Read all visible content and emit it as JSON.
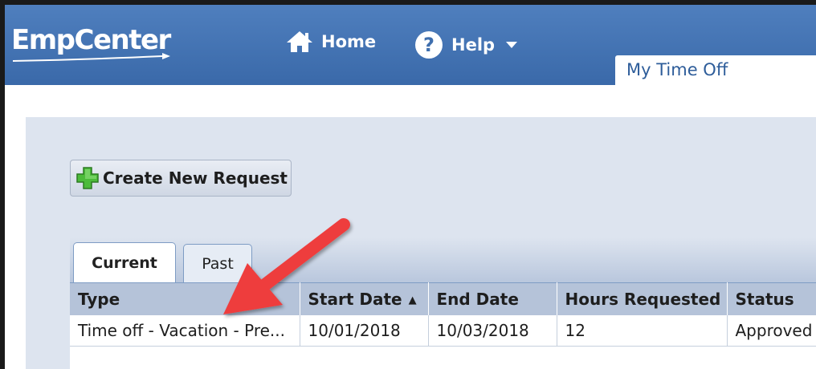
{
  "header": {
    "logo_text": "EmpCenter",
    "nav": {
      "home_label": "Home",
      "help_label": "Help"
    },
    "page_tab_title": "My Time Off"
  },
  "toolbar": {
    "create_label": "Create New Request"
  },
  "tabs": [
    {
      "label": "Current",
      "selected": true
    },
    {
      "label": "Past",
      "selected": false
    }
  ],
  "table": {
    "columns": [
      "Type",
      "Start Date",
      "End Date",
      "Hours Requested",
      "Status"
    ],
    "sorted_column": "Start Date",
    "sort_direction": "ascending",
    "rows": [
      [
        "Time off - Vacation - Pre...",
        "10/01/2018",
        "10/03/2018",
        "12",
        "Approved"
      ]
    ]
  },
  "annotation": {
    "arrow_color": "#ee3e3e"
  },
  "colors": {
    "header_blue": "#3f6fae",
    "content_bg": "#dde4ef",
    "table_header_bg": "#b5c3d9"
  }
}
